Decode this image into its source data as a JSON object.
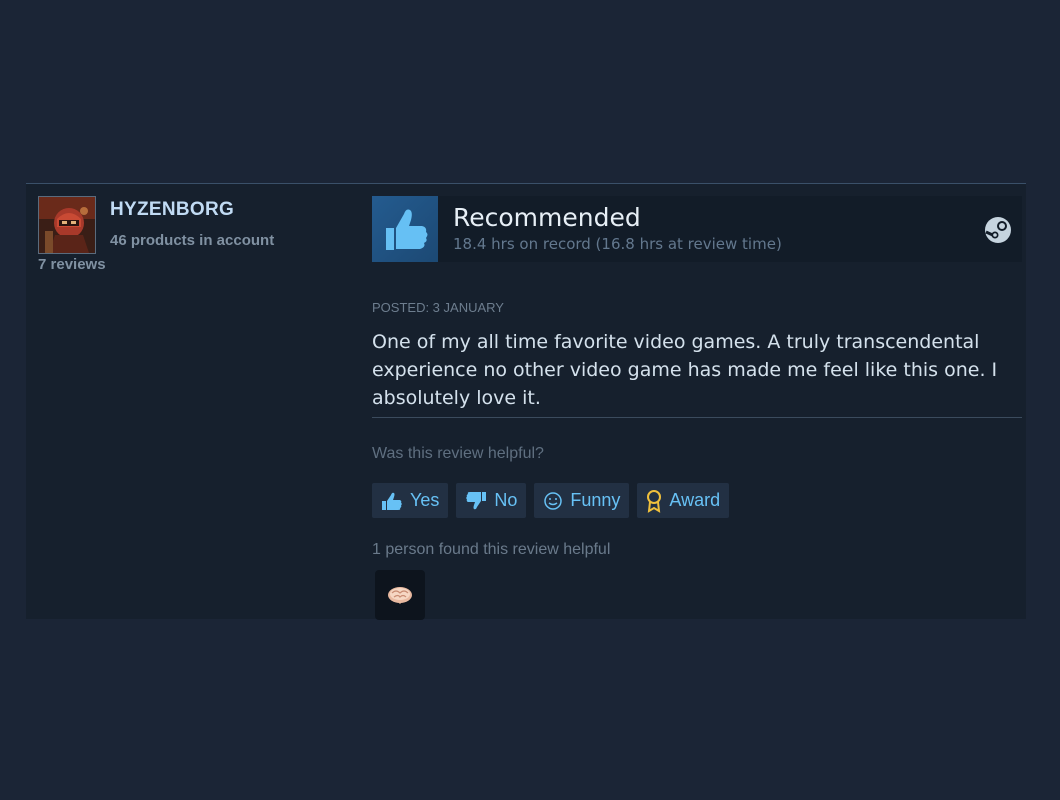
{
  "author": {
    "name": "HYZENBORG",
    "products": "46 products in account",
    "reviews": "7 reviews",
    "avatar_icon": "avatar-red-helmet"
  },
  "review": {
    "verdict": "Recommended",
    "hours": "18.4 hrs on record (16.8 hrs at review time)",
    "posted": "POSTED: 3 JANUARY",
    "text": "One of my all time favorite video games. A truly transcendental experience no other video game has made me feel like this one. I absolutely love it.",
    "platform_icon": "steam-icon"
  },
  "helpful": {
    "question": "Was this review helpful?",
    "buttons": {
      "yes": "Yes",
      "no": "No",
      "funny": "Funny",
      "award": "Award"
    },
    "summary": "1 person found this review helpful",
    "award_icon": "brain-award-icon"
  },
  "colors": {
    "page_bg": "#1b2536",
    "card_bg": "#16202d",
    "link_blue": "#67c1f5",
    "thumb_bg": "#245b8f",
    "author_name": "#c1dbf4",
    "award_gold": "#f0c03c"
  }
}
